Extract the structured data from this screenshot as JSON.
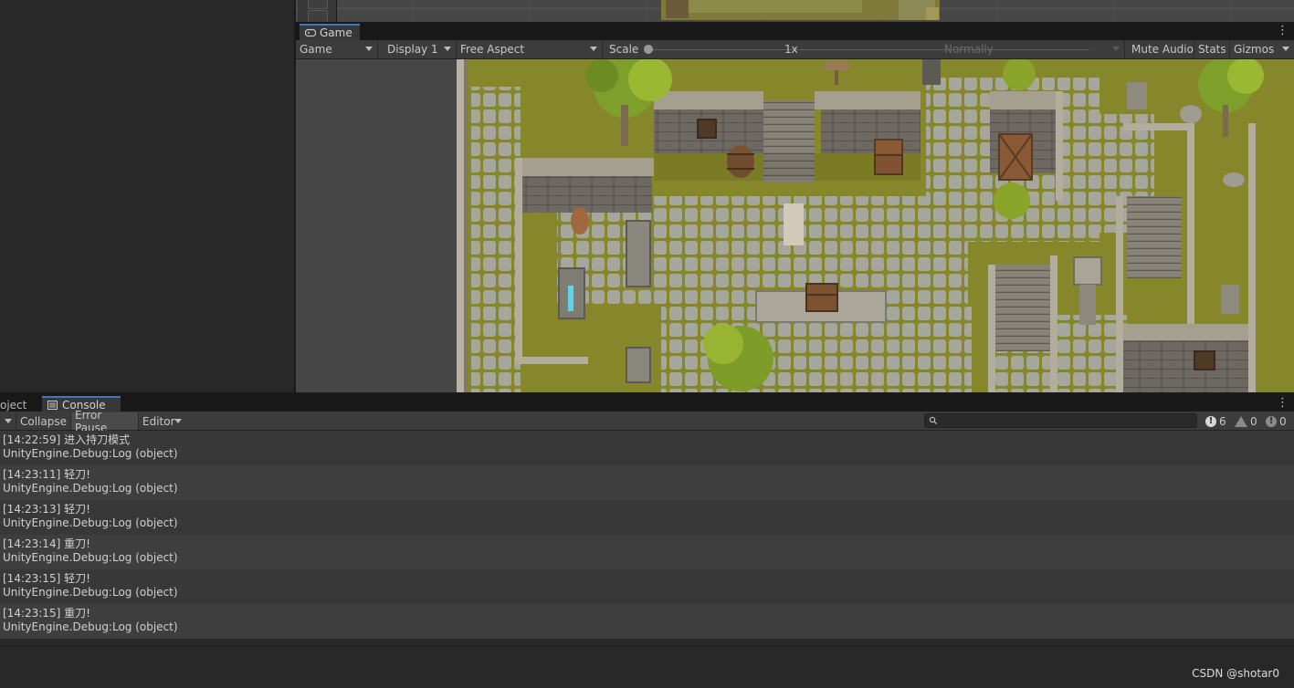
{
  "game_panel": {
    "tab_label": "Game",
    "toolbar": {
      "view_select": "Game",
      "display_select": "Display 1",
      "aspect_select": "Free Aspect",
      "scale_label": "Scale",
      "scale_value": "1x",
      "scale_level": 0,
      "play_focus_select": "Normally",
      "mute_audio_label": "Mute Audio",
      "stats_label": "Stats",
      "gizmos_label": "Gizmos"
    }
  },
  "console_panel": {
    "tabs": [
      {
        "label": "oject",
        "active": false
      },
      {
        "label": "Console",
        "active": true
      }
    ],
    "toolbar": {
      "collapse_label": "Collapse",
      "error_pause_label": "Error Pause",
      "editor_label": "Editor",
      "search_placeholder": "",
      "info_count": "6",
      "warning_count": "0",
      "error_count": "0"
    },
    "logs": [
      {
        "line1": "[14:22:59] 进入持刀模式",
        "line2": "UnityEngine.Debug:Log (object)"
      },
      {
        "line1": "[14:23:11] 轻刀!",
        "line2": "UnityEngine.Debug:Log (object)"
      },
      {
        "line1": "[14:23:13] 轻刀!",
        "line2": "UnityEngine.Debug:Log (object)"
      },
      {
        "line1": "[14:23:14] 重刀!",
        "line2": "UnityEngine.Debug:Log (object)"
      },
      {
        "line1": "[14:23:15] 轻刀!",
        "line2": "UnityEngine.Debug:Log (object)"
      },
      {
        "line1": "[14:23:15] 重刀!",
        "line2": "UnityEngine.Debug:Log (object)"
      }
    ]
  },
  "watermark": "CSDN @shotar0",
  "colors": {
    "panel_bg": "#282828",
    "toolbar_bg": "#3c3c3c",
    "active_tab_accent": "#3a79bb",
    "grass": "#8a8a2a",
    "stone_wall": "#6e6a62",
    "tile": "#a8a8a0"
  }
}
